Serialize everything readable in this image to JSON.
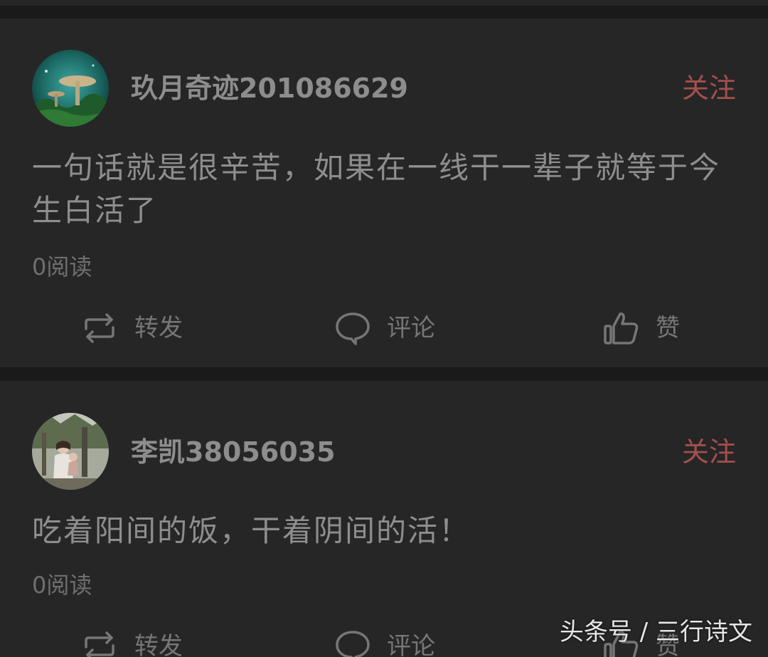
{
  "posts": [
    {
      "username": "玖月奇迹201086629",
      "follow_label": "关注",
      "content": "一句话就是很辛苦，如果在一线干一辈子就等于今生白活了",
      "read_count": "0阅读",
      "actions": {
        "repost_label": "转发",
        "comment_label": "评论",
        "like_label": "赞"
      }
    },
    {
      "username": "李凯38056035",
      "follow_label": "关注",
      "content": "吃着阳间的饭，干着阴间的活！",
      "read_count": "0阅读",
      "actions": {
        "repost_label": "转发",
        "comment_label": "评论",
        "like_label": "赞"
      }
    }
  ],
  "watermark": "头条号 / 三行诗文",
  "colors": {
    "background": "#1a1a1a",
    "card": "#262626",
    "follow_accent": "#a3504d",
    "text": "#8e8e8e",
    "muted": "#6f6f6f"
  },
  "icons": {
    "repost": "repost-icon",
    "comment": "comment-icon",
    "like": "thumbs-up-icon"
  }
}
